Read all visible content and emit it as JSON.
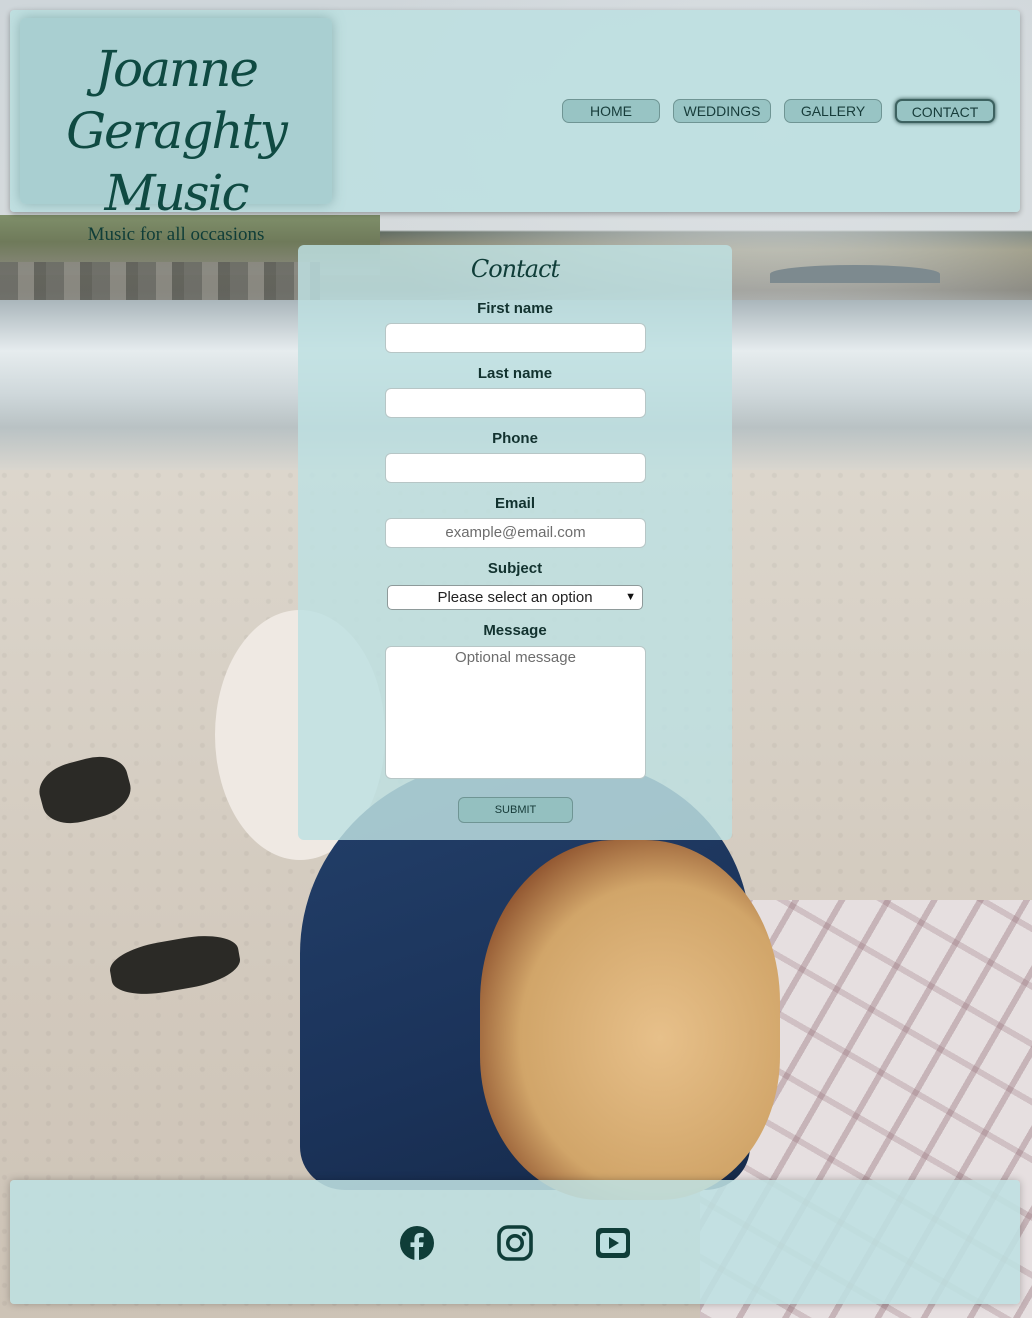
{
  "header": {
    "logo_title": "Joanne Geraghty Music",
    "tagline": "Music for all occasions"
  },
  "nav": {
    "items": [
      {
        "label": "HOME"
      },
      {
        "label": "WEDDINGS"
      },
      {
        "label": "GALLERY"
      },
      {
        "label": "CONTACT",
        "active": true
      }
    ]
  },
  "form": {
    "title": "Contact",
    "first_name_label": "First name",
    "first_name_value": "",
    "last_name_label": "Last name",
    "last_name_value": "",
    "phone_label": "Phone",
    "phone_value": "",
    "email_label": "Email",
    "email_placeholder": "example@email.com",
    "subject_label": "Subject",
    "subject_selected": "Please select an option",
    "message_label": "Message",
    "message_placeholder": "Optional message",
    "submit_label": "SUBMIT"
  },
  "footer": {
    "social": [
      "facebook-icon",
      "instagram-icon",
      "youtube-icon"
    ]
  },
  "colors": {
    "panel": "#bee0e1",
    "brand_text": "#0f4a42",
    "button": "#98c4c4"
  }
}
